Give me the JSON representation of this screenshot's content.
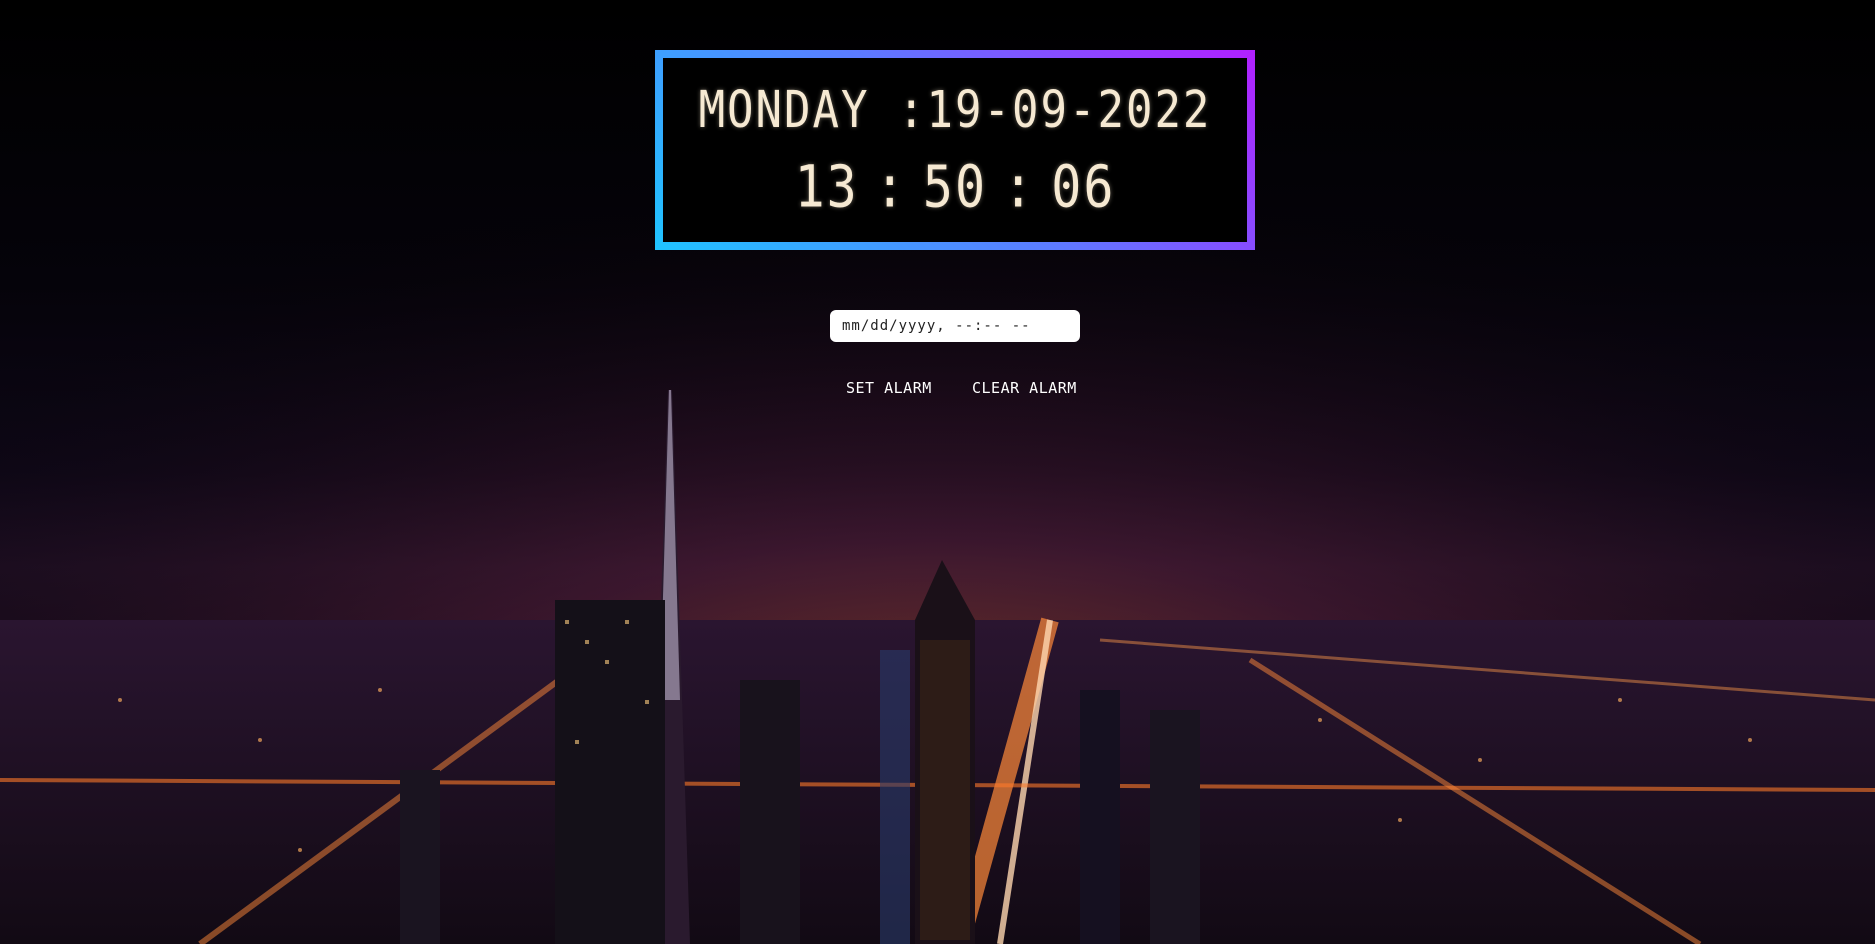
{
  "clock": {
    "day": "MONDAY",
    "date_separator": ":",
    "date": "19-09-2022",
    "hours": "13",
    "minutes": "50",
    "seconds": "06",
    "time_separator": ":"
  },
  "alarm": {
    "input_placeholder": "mm/dd/yyyy, --:-- --",
    "set_label": "Set Alarm",
    "clear_label": "Clear Alarm"
  },
  "colors": {
    "frame_start": "#1fc4ff",
    "frame_end": "#b21fff",
    "digits": "#f6e9d2"
  },
  "icons": {
    "calendar": "calendar-icon"
  }
}
